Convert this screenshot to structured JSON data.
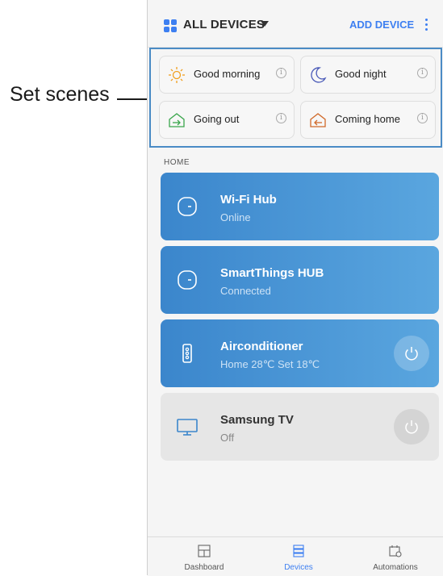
{
  "callout": {
    "label": "Set scenes"
  },
  "header": {
    "title": "ALL DEVICES",
    "add_label": "ADD DEVICE"
  },
  "scenes": [
    {
      "label": "Good morning",
      "icon": "sun-icon"
    },
    {
      "label": "Good night",
      "icon": "moon-icon"
    },
    {
      "label": "Going out",
      "icon": "house-exit-icon"
    },
    {
      "label": "Coming home",
      "icon": "house-enter-icon"
    }
  ],
  "section": {
    "label": "HOME"
  },
  "devices": [
    {
      "name": "Wi-Fi Hub",
      "status": "Online",
      "icon": "hub-icon",
      "active": true
    },
    {
      "name": "SmartThings HUB",
      "status": "Connected",
      "icon": "hub-icon",
      "active": true
    },
    {
      "name": "Airconditioner",
      "status": "Home 28℃  Set 18℃",
      "icon": "remote-icon",
      "active": true
    },
    {
      "name": "Samsung TV",
      "status": "Off",
      "icon": "tv-icon",
      "active": false
    }
  ],
  "nav": [
    {
      "label": "Dashboard"
    },
    {
      "label": "Devices"
    },
    {
      "label": "Automations"
    }
  ],
  "colors": {
    "accent": "#3d7ff1",
    "card": "#4a95d6",
    "callout_border": "#4a8bc5"
  }
}
